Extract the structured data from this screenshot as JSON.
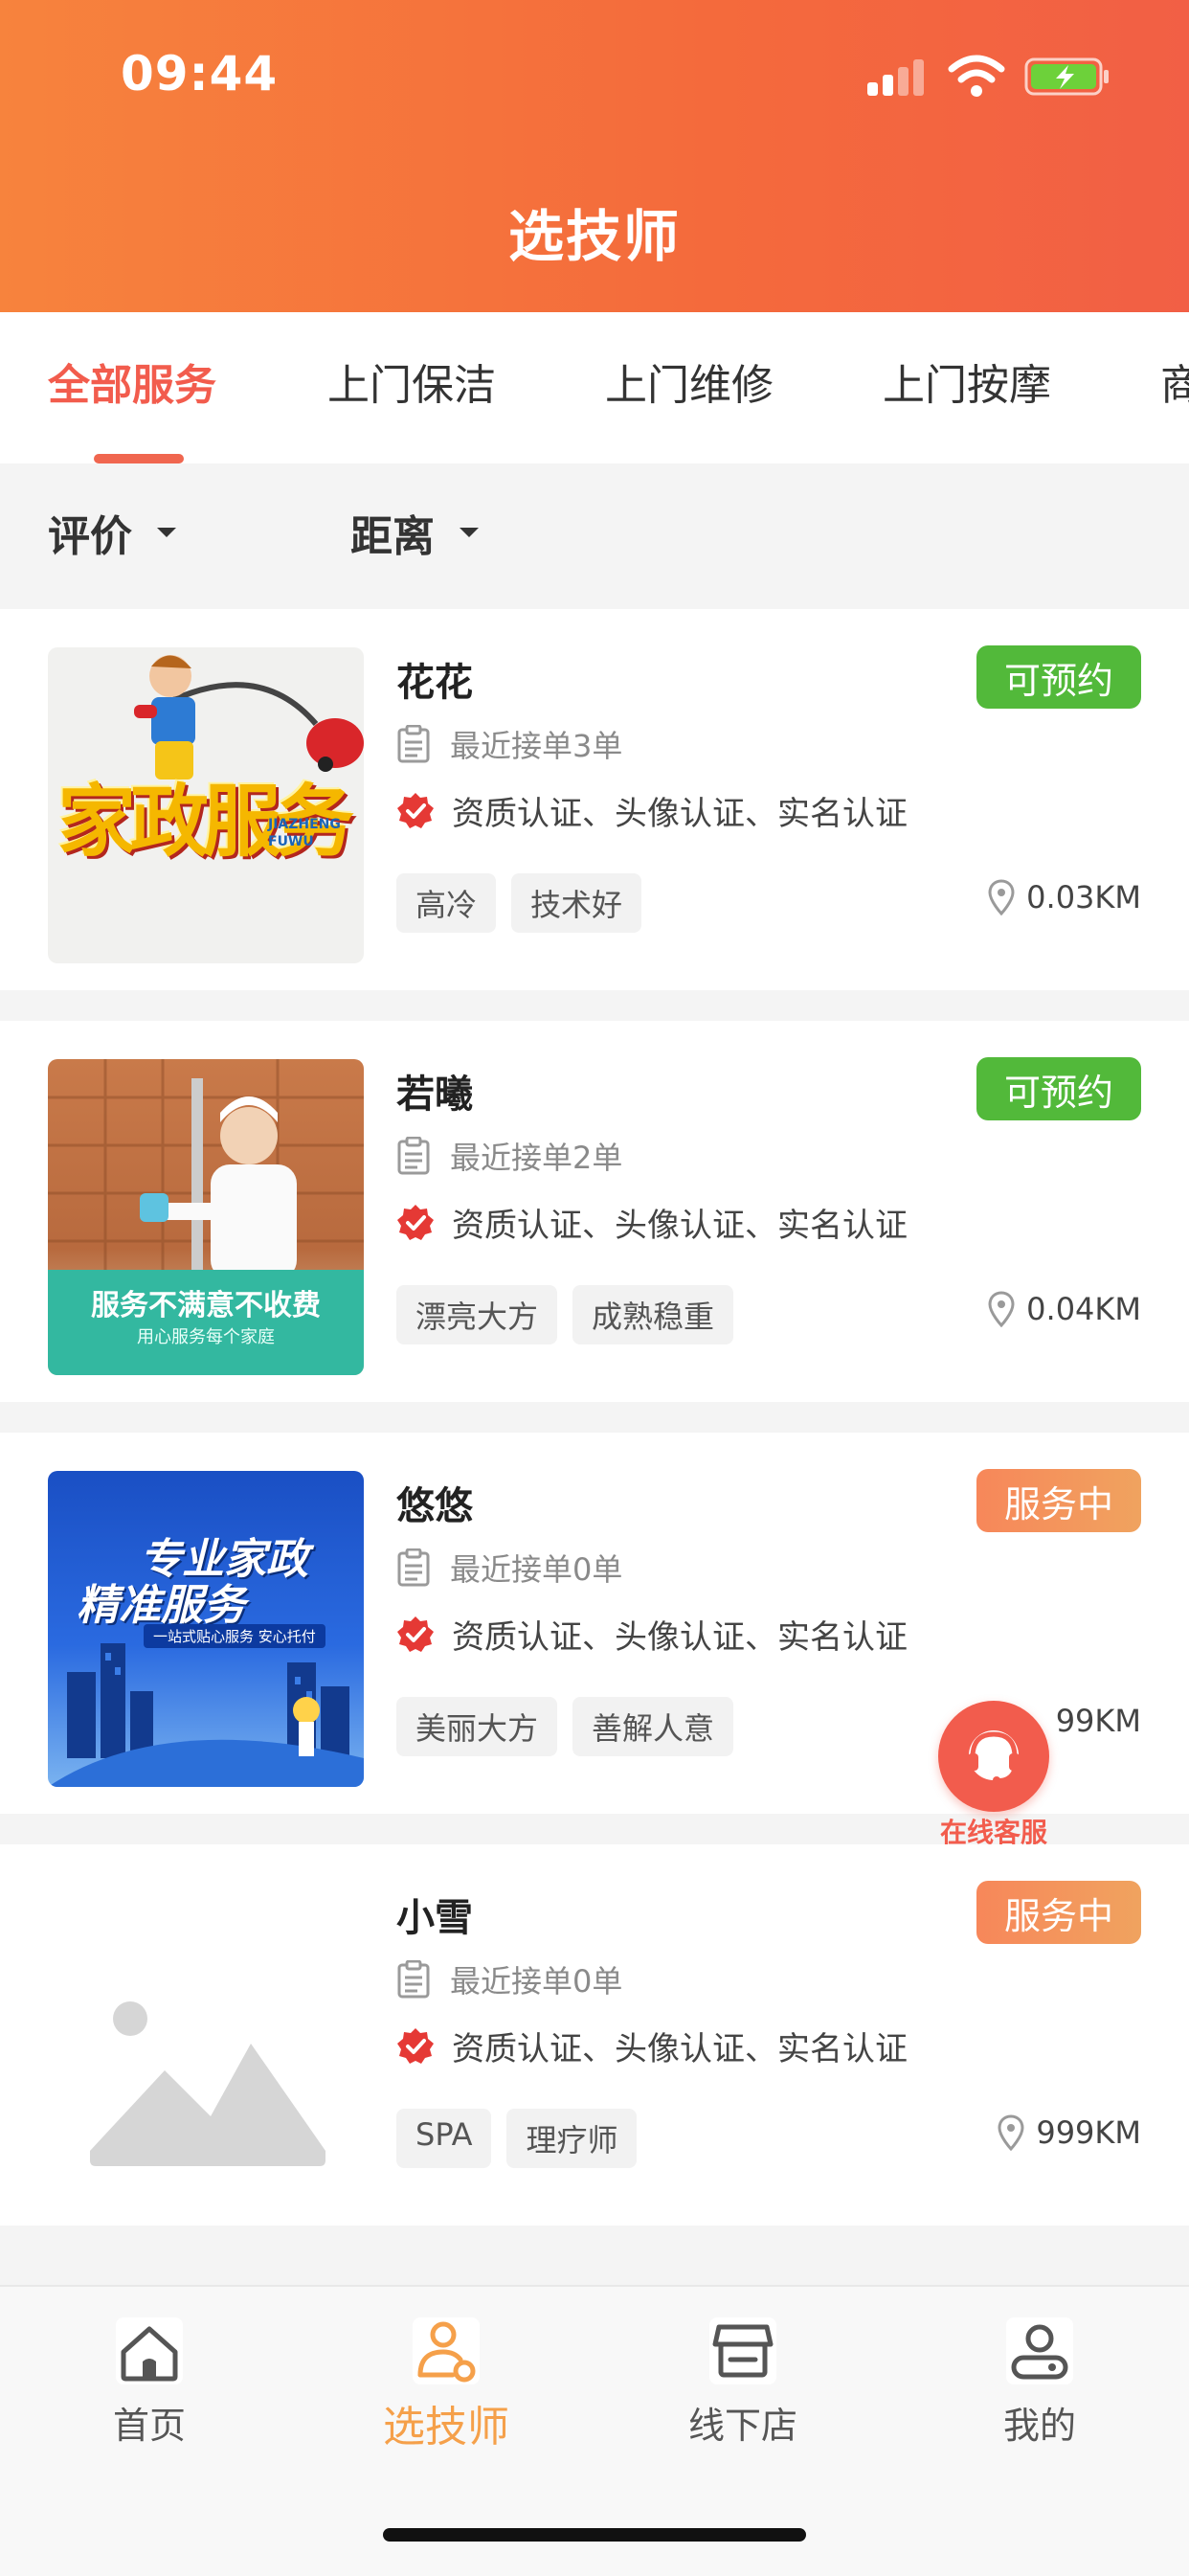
{
  "status_bar": {
    "time": "09:44"
  },
  "header": {
    "title": "选技师"
  },
  "tabs": [
    {
      "label": "全部服务"
    },
    {
      "label": "上门保洁"
    },
    {
      "label": "上门维修"
    },
    {
      "label": "上门按摩"
    },
    {
      "label": "商"
    }
  ],
  "filters": [
    {
      "label": "评价"
    },
    {
      "label": "距离"
    }
  ],
  "technicians": [
    {
      "name": "花花",
      "status": "可预约",
      "orders": "最近接单3单",
      "certs": "资质认证、头像认证、实名认证",
      "tags": [
        "高冷",
        "技术好"
      ],
      "distance": "0.03KM",
      "thumb": {
        "title": "家政服务",
        "subtitle": "JIAZHENG FUWU"
      }
    },
    {
      "name": "若曦",
      "status": "可预约",
      "orders": "最近接单2单",
      "certs": "资质认证、头像认证、实名认证",
      "tags": [
        "漂亮大方",
        "成熟稳重"
      ],
      "distance": "0.04KM",
      "thumb": {
        "title": "服务不满意不收费",
        "subtitle": "用心服务每个家庭"
      }
    },
    {
      "name": "悠悠",
      "status": "服务中",
      "orders": "最近接单0单",
      "certs": "资质认证、头像认证、实名认证",
      "tags": [
        "美丽大方",
        "善解人意"
      ],
      "distance": "99KM",
      "thumb": {
        "title": "专业家政",
        "title2": "精准服务",
        "subtitle": "一站式贴心服务 安心托付"
      }
    },
    {
      "name": "小雪",
      "status": "服务中",
      "orders": "最近接单0单",
      "certs": "资质认证、头像认证、实名认证",
      "tags": [
        "SPA",
        "理疗师"
      ],
      "distance": "999KM"
    }
  ],
  "float_service": {
    "label": "在线客服"
  },
  "bottom_nav": [
    {
      "label": "首页",
      "icon": "home-icon"
    },
    {
      "label": "选技师",
      "icon": "technician-icon",
      "active": true
    },
    {
      "label": "线下店",
      "icon": "store-icon"
    },
    {
      "label": "我的",
      "icon": "profile-icon"
    }
  ],
  "colors": {
    "accent": "#f25c4d",
    "available": "#52b93a",
    "busy": "#f7875a",
    "nav_active": "#f5a04a"
  }
}
